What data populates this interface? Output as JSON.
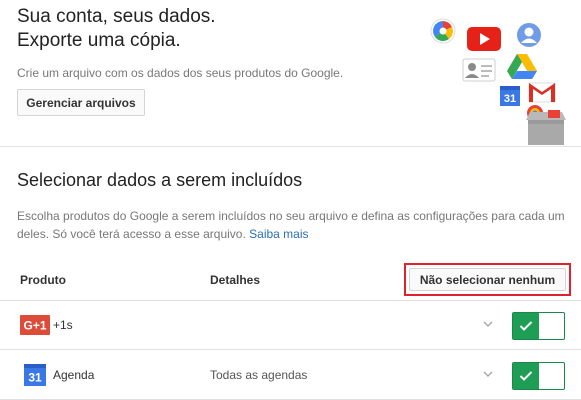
{
  "header": {
    "title_line1": "Sua conta, seus dados.",
    "title_line2": "Exporte uma cópia.",
    "subtitle": "Crie um arquivo com os dados dos seus produtos do Google.",
    "manage_button": "Gerenciar arquivos"
  },
  "product_icons": [
    "photos-icon",
    "youtube-icon",
    "google-plus-profile-icon",
    "contacts-icon",
    "drive-icon",
    "gmail-icon",
    "calendar-icon",
    "hangouts-icon",
    "archive-box-icon"
  ],
  "section": {
    "title": "Selecionar dados a serem incluídos",
    "description": "Escolha produtos do Google a serem incluídos no seu arquivo e defina as configurações para cada um deles. Só você terá acesso a esse arquivo.",
    "learn_more": "Saiba mais"
  },
  "table": {
    "col_product": "Produto",
    "col_details": "Detalhes",
    "select_none_button": "Não selecionar nenhum",
    "rows": [
      {
        "icon": "gplus-one-icon",
        "icon_text": "G+1",
        "name": "+1s",
        "details": "",
        "enabled": true
      },
      {
        "icon": "calendar-icon",
        "icon_text": "31",
        "name": "Agenda",
        "details": "Todas as agendas",
        "enabled": true
      }
    ]
  },
  "colors": {
    "toggle_on": "#1e9e55",
    "highlight": "#e0222e",
    "link": "#2a6ebb"
  }
}
